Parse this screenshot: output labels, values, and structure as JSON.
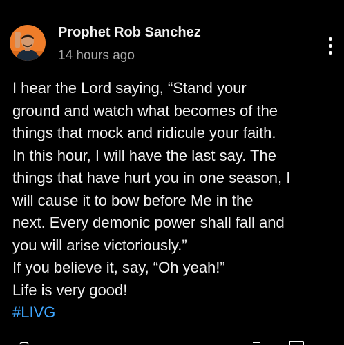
{
  "post": {
    "author": "Prophet Rob Sanchez",
    "timestamp": "14 hours ago",
    "body_lines": [
      "I hear the Lord saying, “Stand your",
      "ground and watch what becomes of the",
      "things that mock and ridicule your faith.",
      "In this hour, I will have the last say. The",
      "things that have hurt you in one season, I",
      "will cause it to bow before Me in the",
      "next. Every demonic power shall fall and",
      "you will arise victoriously.”",
      "If you believe it, say, “Oh yeah!”",
      "Life is very good!"
    ],
    "hashtag": "#LIVG"
  },
  "icons": {
    "more": "more-vertical-icon",
    "avatar": "avatar"
  },
  "colors": {
    "background": "#000000",
    "text": "#f1f1f1",
    "secondary_text": "#aaaaaa",
    "hashtag": "#3ea6ff",
    "avatar_bg": "#ef7d2a"
  }
}
